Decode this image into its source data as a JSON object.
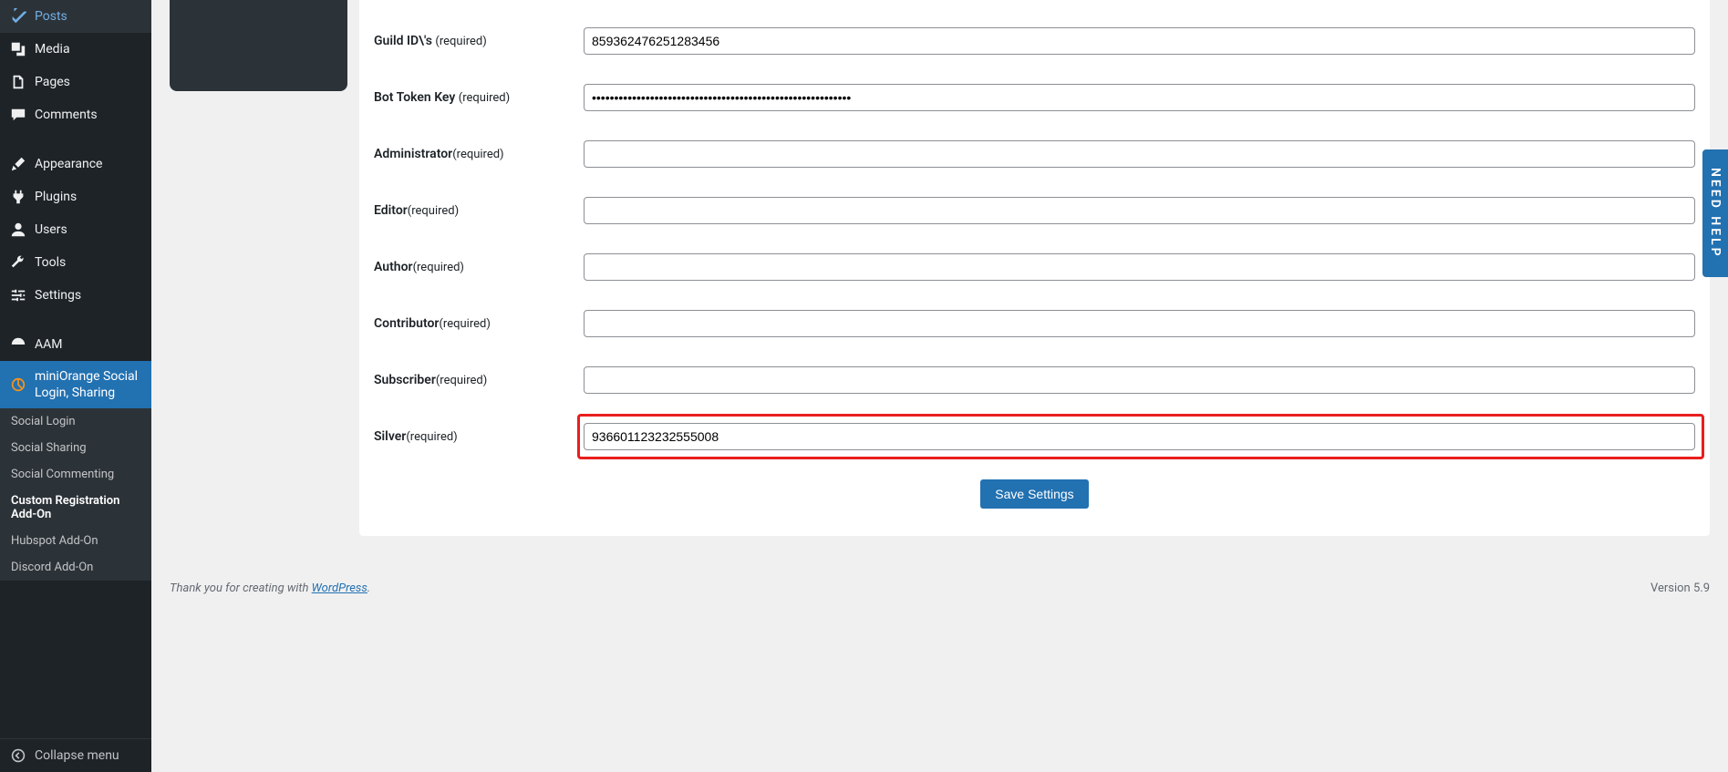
{
  "sidebar": {
    "posts": "Posts",
    "media": "Media",
    "pages": "Pages",
    "comments": "Comments",
    "appearance": "Appearance",
    "plugins": "Plugins",
    "users": "Users",
    "tools": "Tools",
    "settings": "Settings",
    "aam": "AAM",
    "miniOrange": "miniOrange Social Login, Sharing"
  },
  "submenu": {
    "socialLogin": "Social Login",
    "socialSharing": "Social Sharing",
    "socialCommenting": "Social Commenting",
    "customRegistration": "Custom Registration Add-On",
    "hubspot": "Hubspot Add-On",
    "discord": "Discord Add-On"
  },
  "collapse": "Collapse menu",
  "form": {
    "guildId": {
      "label": "Guild ID\\'s ",
      "req": "(required)",
      "value": "859362476251283456"
    },
    "botToken": {
      "label": "Bot Token Key ",
      "req": "(required)",
      "value": "••••••••••••••••••••••••••••••••••••••••••••••••••••••••••"
    },
    "administrator": {
      "label": "Administrator",
      "req": "(required)",
      "value": ""
    },
    "editor": {
      "label": "Editor",
      "req": "(required)",
      "value": ""
    },
    "author": {
      "label": "Author",
      "req": "(required)",
      "value": ""
    },
    "contributor": {
      "label": "Contributor",
      "req": "(required)",
      "value": ""
    },
    "subscriber": {
      "label": "Subscriber",
      "req": "(required)",
      "value": ""
    },
    "silver": {
      "label": "Silver",
      "req": "(required)",
      "value": "936601123232555008"
    }
  },
  "saveBtn": "Save Settings",
  "footer": {
    "thankyou": "Thank you for creating with ",
    "wordpress": "WordPress",
    "period": ".",
    "version": "Version 5.9"
  },
  "helpTab": "NEED HELP"
}
